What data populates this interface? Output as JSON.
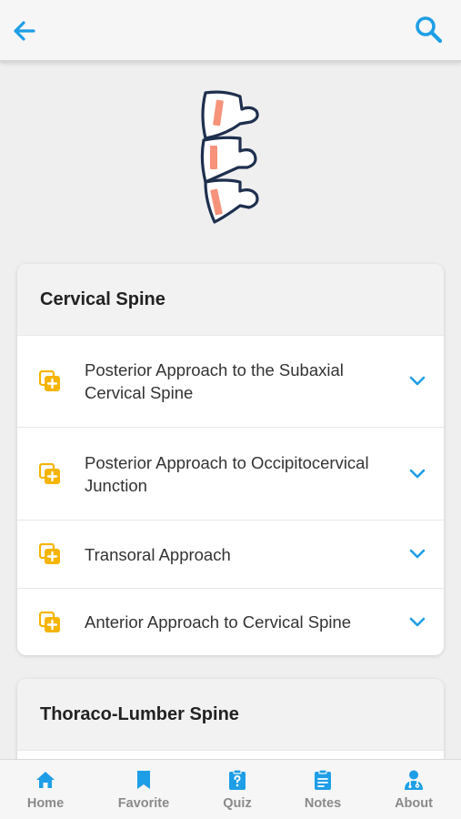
{
  "colors": {
    "accent": "#1e9ee6",
    "item_icon": "#f5b400",
    "hero_outline": "#1f2f4e",
    "hero_fill": "#f6937a"
  },
  "topbar": {
    "back_icon": "arrow-left-icon",
    "search_icon": "search-icon"
  },
  "hero": {
    "icon": "spine-vertebrae-icon"
  },
  "sections": [
    {
      "title": "Cervical Spine",
      "items": [
        {
          "label": "Posterior Approach to the Subaxial Cervical Spine",
          "icon": "add-to-collection-icon",
          "expand_icon": "chevron-down-icon"
        },
        {
          "label": "Posterior Approach to Occipitocervical Junction",
          "icon": "add-to-collection-icon",
          "expand_icon": "chevron-down-icon"
        },
        {
          "label": "Transoral Approach",
          "icon": "add-to-collection-icon",
          "expand_icon": "chevron-down-icon"
        },
        {
          "label": "Anterior Approach to Cervical Spine",
          "icon": "add-to-collection-icon",
          "expand_icon": "chevron-down-icon"
        }
      ]
    },
    {
      "title": "Thoraco-Lumber Spine",
      "items": []
    }
  ],
  "bottom_nav": [
    {
      "label": "Home",
      "icon": "home-icon"
    },
    {
      "label": "Favorite",
      "icon": "bookmark-icon"
    },
    {
      "label": "Quiz",
      "icon": "quiz-clipboard-icon"
    },
    {
      "label": "Notes",
      "icon": "notes-clipboard-icon"
    },
    {
      "label": "About",
      "icon": "doctor-icon"
    }
  ]
}
